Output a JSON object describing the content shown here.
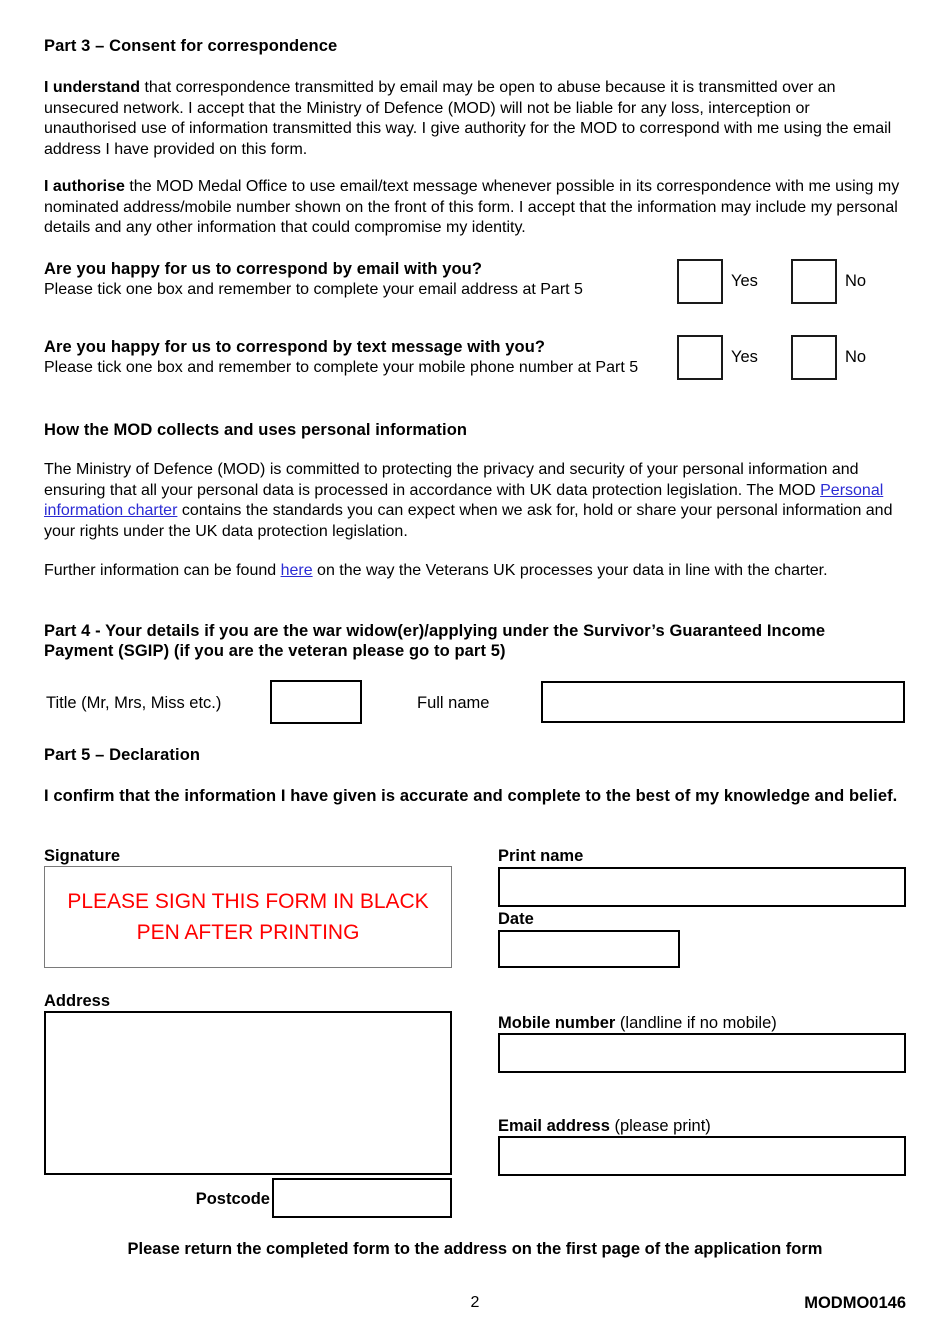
{
  "document": {
    "part3": {
      "heading": "Part 3 – Consent for correspondence",
      "para1_bold": "I understand",
      "para1_rest": " that correspondence transmitted by email may be open to abuse because it is transmitted over an unsecured network. I accept that the Ministry of Defence (MOD) will not be liable for any loss, interception or unauthorised use of information transmitted this way. I give authority for the MOD to correspond with me using the email address I have provided on this form.",
      "para2_bold": "I authorise",
      "para2_rest": " the MOD Medal Office to use email/text message whenever possible in its correspondence with me using my nominated address/mobile number shown on the front of this form. I accept that the information may include my personal details and any other information that could compromise my identity."
    },
    "email_consent": {
      "question": "Are you happy for us to correspond by email with you?",
      "instruction": "Please tick one box and remember to complete your email address at Part 5",
      "yes_label": "Yes",
      "no_label": "No"
    },
    "text_consent": {
      "question": "Are you happy for us to correspond by text message with you?",
      "instruction": "Please tick one box and remember to complete your mobile phone number at Part 5",
      "yes_label": "Yes",
      "no_label": "No"
    },
    "privacy": {
      "heading": "How the MOD collects and uses personal information",
      "para1_a": "The Ministry of Defence (MOD) is committed to protecting the privacy and security of your personal information and ensuring that all your personal data is processed in accordance with UK data protection legislation. The MOD ",
      "para1_link": "Personal information charter",
      "para1_b": " contains the standards you can expect when we ask for, hold or share your personal information and your rights under the UK data protection legislation.",
      "para2_a": "Further information can be found ",
      "para2_link": "here",
      "para2_b": " on the way the Veterans UK processes your data in line with the charter."
    },
    "part4": {
      "heading": "Part 4 - Your details if you are the war widow(er)/applying under the Survivor’s Guaranteed Income Payment (SGIP) (if you are the veteran please go to part 5)",
      "title_label": "Title (Mr, Mrs, Miss etc.)",
      "title_value": "",
      "fullname_label": "Full name",
      "fullname_value": ""
    },
    "part5": {
      "heading": "Part 5 – Declaration",
      "confirm_text": "I confirm that the information I have given is accurate and complete to the best of my knowledge and belief.",
      "signature_label": "Signature",
      "signature_notice_line1": "PLEASE SIGN THIS FORM IN BLACK",
      "signature_notice_line2": "PEN AFTER PRINTING",
      "print_name_label": "Print name",
      "print_name_value": "",
      "date_label": "Date",
      "date_value": "",
      "address_label": "Address",
      "address_value": "",
      "postcode_label": "Postcode",
      "postcode_value": "",
      "mobile_label_bold": "Mobile number",
      "mobile_label_rest": " (landline if no mobile)",
      "mobile_value": "",
      "email_label_bold": "Email address",
      "email_label_rest": " (please print)",
      "email_value": ""
    },
    "footer": {
      "return_note": "Please return the completed form to the address on the first page of the application form",
      "page_number": "2",
      "form_code": "MODMO0146"
    },
    "colors": {
      "link": "#2b2bd4",
      "signature_notice": "#ff0000",
      "text": "#000000",
      "border": "#000000"
    }
  }
}
